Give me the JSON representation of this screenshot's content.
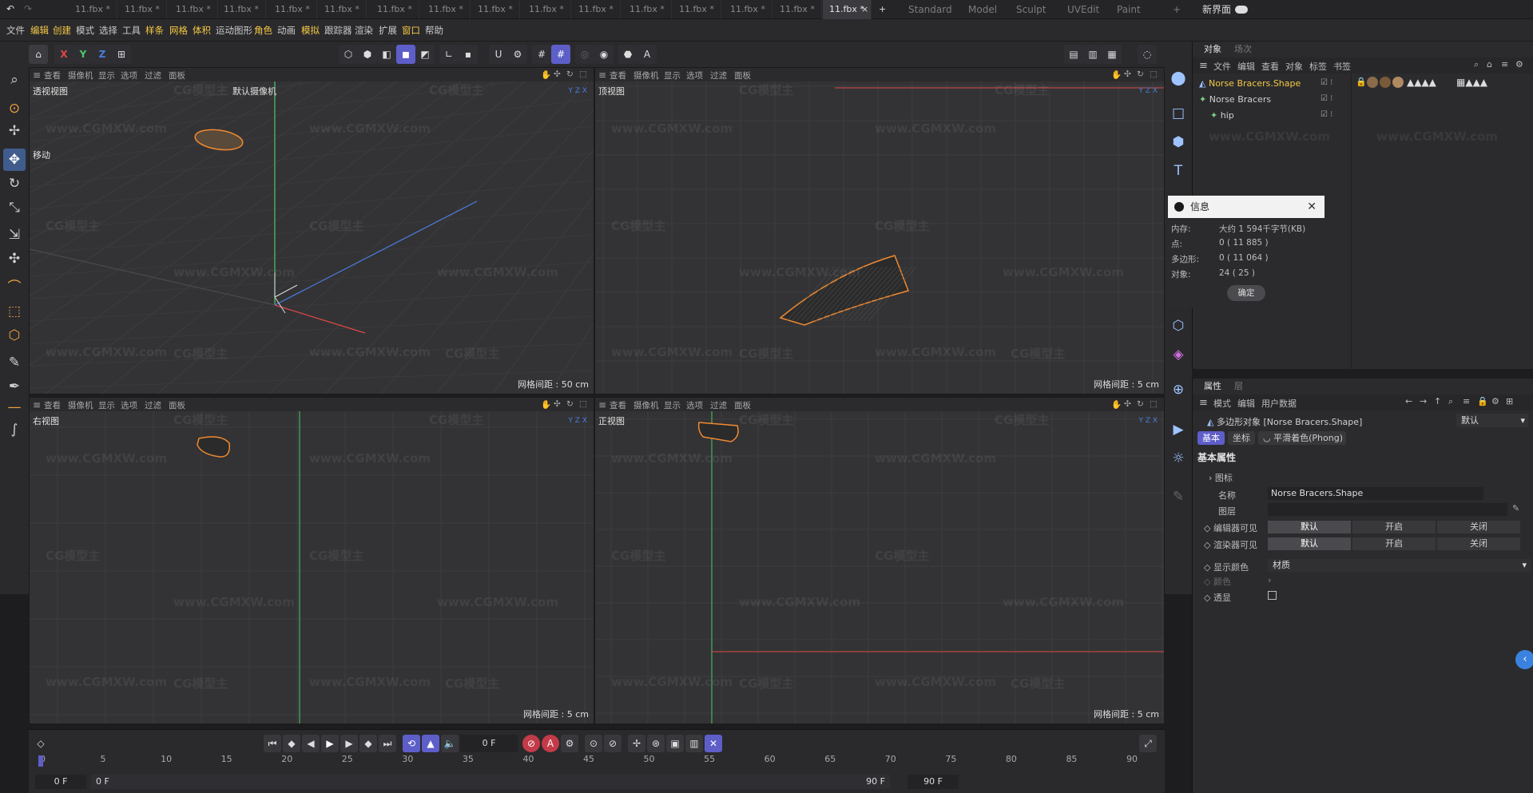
{
  "titlebar": {
    "tabs": [
      "11.fbx *",
      "11.fbx *",
      "11.fbx *",
      "11.fbx *",
      "11.fbx *",
      "11.fbx *",
      "11.fbx *",
      "11.fbx *",
      "11.fbx *",
      "11.fbx *",
      "11.fbx *",
      "11.fbx *",
      "11.fbx *",
      "11.fbx *",
      "11.fbx *",
      "11.fbx *"
    ],
    "active_tab": "11.fbx *",
    "close_glyph": "×",
    "add_tab_glyph": "+",
    "layouts": [
      "Standard",
      "Model",
      "Sculpt",
      "UVEdit",
      "Paint"
    ],
    "add_layout_glyph": "+",
    "new_ui_label": "新界面"
  },
  "menubar": {
    "items": [
      "文件",
      "编辑",
      "创建",
      "模式",
      "选择",
      "工具",
      "样条",
      "网格",
      "体积",
      "运动图形",
      "角色",
      "动画",
      "模拟",
      "跟踪器",
      "渲染",
      "扩展",
      "窗口",
      "帮助"
    ]
  },
  "toolbar": {
    "axis_x": "X",
    "axis_y": "Y",
    "axis_z": "Z"
  },
  "viewports": [
    {
      "name": "透视视图",
      "camera": "默认摄像机",
      "menu": [
        "查看",
        "摄像机",
        "显示",
        "选项",
        "过滤",
        "面板"
      ],
      "grid_label": "网格间距 : 50 cm",
      "move_label": "移动"
    },
    {
      "name": "顶视图",
      "menu": [
        "查看",
        "摄像机",
        "显示",
        "选项",
        "过滤",
        "面板"
      ],
      "grid_label": "网格间距 : 5 cm"
    },
    {
      "name": "右视图",
      "menu": [
        "查看",
        "摄像机",
        "显示",
        "选项",
        "过滤",
        "面板"
      ],
      "grid_label": "网格间距 : 5 cm"
    },
    {
      "name": "正视图",
      "menu": [
        "查看",
        "摄像机",
        "显示",
        "选项",
        "过滤",
        "面板"
      ],
      "grid_label": "网格间距 : 5 cm"
    }
  ],
  "watermark": {
    "logo": "CG模型主",
    "url": "www.CGMXW.com"
  },
  "object_panel": {
    "tabs": [
      "对象",
      "场次"
    ],
    "menu": [
      "文件",
      "编辑",
      "查看",
      "对象",
      "标签",
      "书签"
    ],
    "objects": [
      {
        "name": "Norse Bracers.Shape",
        "selected": true
      },
      {
        "name": "Norse Bracers",
        "selected": false
      },
      {
        "name": "hip",
        "selected": false
      }
    ]
  },
  "info_dialog": {
    "title": "信息",
    "rows": [
      {
        "label": "内存:",
        "value": "大约 1 594千字节(KB)"
      },
      {
        "label": "点:",
        "value": "0 ( 11 885 )"
      },
      {
        "label": "多边形:",
        "value": "0 ( 11 064 )"
      },
      {
        "label": "对象:",
        "value": "24 ( 25 )"
      }
    ],
    "ok_label": "确定"
  },
  "attr_panel": {
    "tabs": [
      "属性",
      "层"
    ],
    "menu": [
      "模式",
      "编辑",
      "用户数据"
    ],
    "object_title": "多边形对象 [Norse Bracers.Shape]",
    "preset": "默认",
    "subtabs": [
      "基本",
      "坐标",
      "平滑着色(Phong)"
    ],
    "section": "基本属性",
    "icon_label": "图标",
    "name_label": "名称",
    "name_value": "Norse Bracers.Shape",
    "layer_label": "图层",
    "editor_visible_label": "编辑器可见",
    "render_visible_label": "渲染器可见",
    "visible_options": [
      "默认",
      "开启",
      "关闭"
    ],
    "display_color_label": "显示颜色",
    "display_color_value": "材质",
    "color_label": "颜色",
    "xray_label": "透显"
  },
  "timeline": {
    "ticks": [
      "0",
      "5",
      "10",
      "15",
      "20",
      "25",
      "30",
      "35",
      "40",
      "45",
      "50",
      "55",
      "60",
      "65",
      "70",
      "75",
      "80",
      "85",
      "90"
    ],
    "current_frame": "0 F",
    "start_frame": "0 F",
    "range_start": "0 F",
    "range_end": "90 F",
    "end_frame": "90 F"
  },
  "colors": {
    "accent": "#5e5ec9",
    "selected_obj": "#f5c842",
    "x_axis": "#e04848",
    "y_axis": "#4cc86a",
    "z_axis": "#4a7de0"
  }
}
